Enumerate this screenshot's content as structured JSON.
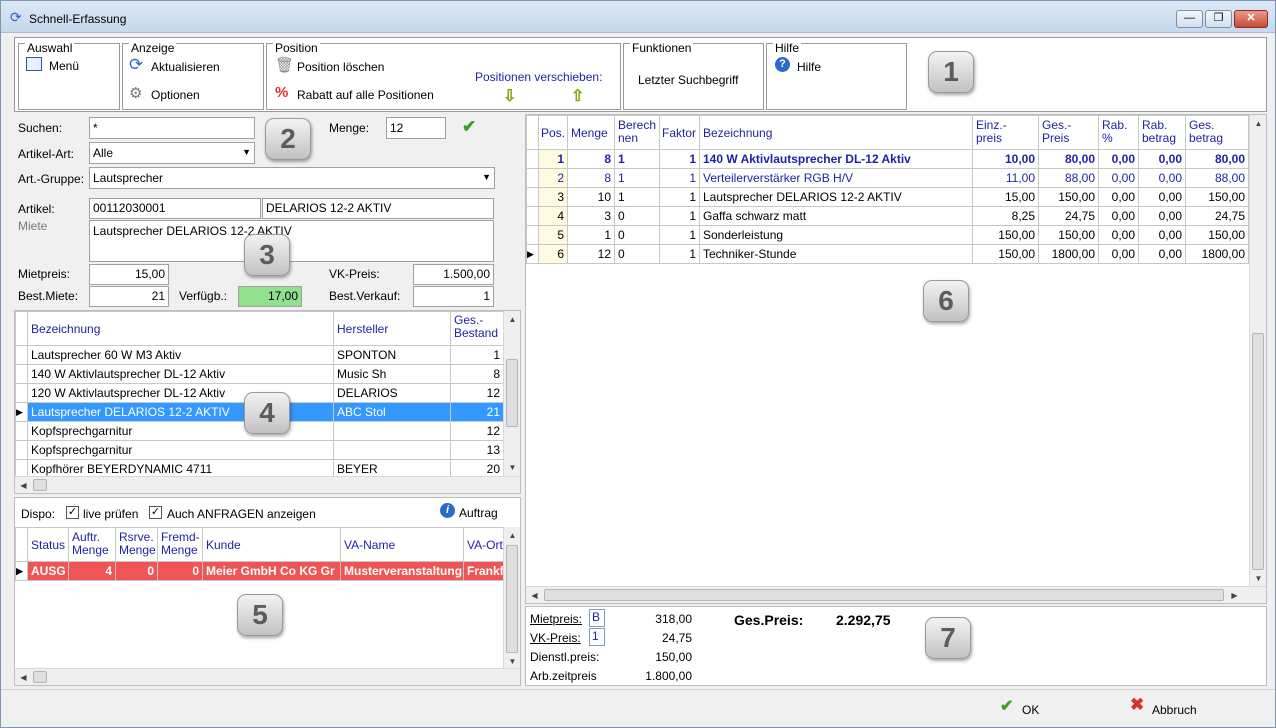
{
  "window": {
    "title": "Schnell-Erfassung",
    "min": "—",
    "max": "❐",
    "close": "✕"
  },
  "toolbar": {
    "auswahl": {
      "label": "Auswahl",
      "menu": "Menü"
    },
    "anzeige": {
      "label": "Anzeige",
      "refresh": "Aktualisieren",
      "options": "Optionen"
    },
    "position": {
      "label": "Position",
      "delete": "Position löschen",
      "discount": "Rabatt auf alle Positionen",
      "move_label": "Positionen verschieben:"
    },
    "funktionen": {
      "label": "Funktionen",
      "last_search": "Letzter Suchbegriff"
    },
    "hilfe": {
      "label": "Hilfe",
      "help": "Hilfe"
    }
  },
  "badges": [
    "1",
    "2",
    "3",
    "4",
    "5",
    "6",
    "7"
  ],
  "search": {
    "suchen_label": "Suchen:",
    "suchen_value": "*",
    "menge_label": "Menge:",
    "menge_value": "12",
    "artikelart_label": "Artikel-Art:",
    "artikelart_value": "Alle",
    "artgruppe_label": "Art.-Gruppe:",
    "artgruppe_value": "Lautsprecher"
  },
  "article": {
    "artikel_label": "Artikel:",
    "artikel_nr": "00112030001",
    "artikel_name": "DELARIOS 12-2 AKTIV",
    "miete_label": "Miete",
    "description": "Lautsprecher DELARIOS 12-2 AKTIV",
    "mietpreis_label": "Mietpreis:",
    "mietpreis": "15,00",
    "vkpreis_label": "VK-Preis:",
    "vkpreis": "1.500,00",
    "bestmiete_label": "Best.Miete:",
    "bestmiete": "21",
    "verfuegb_label": "Verfügb.:",
    "verfuegb": "17,00",
    "bestverkauf_label": "Best.Verkauf:",
    "bestverkauf": "1"
  },
  "article_list": {
    "headers": [
      "Bezeichnung",
      "Hersteller",
      "Ges.-\nBestand"
    ],
    "rows": [
      [
        "Lautsprecher 60 W M3 Aktiv",
        "SPONTON",
        "1"
      ],
      [
        "140 W Aktivlautsprecher DL-12 Aktiv",
        "Music Sh",
        "8"
      ],
      [
        "120 W Aktivlautsprecher DL-12 Aktiv",
        "DELARIOS",
        "12"
      ],
      [
        "Lautsprecher DELARIOS 12-2 AKTIV",
        "ABC Stol",
        "21"
      ],
      [
        "Kopfsprechgarnitur",
        "",
        "12"
      ],
      [
        "Kopfsprechgarnitur",
        "",
        "13"
      ],
      [
        "Kopfhörer BEYERDYNAMIC 4711",
        "BEYER",
        "20"
      ]
    ],
    "selected_index": 3
  },
  "dispo": {
    "label": "Dispo:",
    "live_label": "live prüfen",
    "anfragen_label": "Auch ANFRAGEN anzeigen",
    "auftrag_label": "Auftrag",
    "headers": [
      "Status",
      "Auftr.\nMenge",
      "Rsrve.\nMenge",
      "Fremd-\nMenge",
      "Kunde",
      "VA-Name",
      "VA-Ort"
    ],
    "rows": [
      [
        "AUSG",
        "4",
        "0",
        "0",
        "Meier GmbH  Co KG Gr",
        "Musterveranstaltung",
        "Frankf"
      ]
    ]
  },
  "positions": {
    "headers": [
      "Pos.",
      "Menge",
      "Berech\nnen",
      "Faktor",
      "Bezeichnung",
      "Einz.-\npreis",
      "Ges.-\nPreis",
      "Rab.\n%",
      "Rab.\nbetrag",
      "Ges.\nbetrag"
    ],
    "rows": [
      [
        "1",
        "8",
        "1",
        "1",
        "140 W Aktivlautsprecher DL-12 Aktiv",
        "10,00",
        "80,00",
        "0,00",
        "0,00",
        "80,00"
      ],
      [
        "2",
        "8",
        "1",
        "1",
        "Verteilerverstärker RGB H/V",
        "11,00",
        "88,00",
        "0,00",
        "0,00",
        "88,00"
      ],
      [
        "3",
        "10",
        "1",
        "1",
        "Lautsprecher DELARIOS 12-2 AKTIV",
        "15,00",
        "150,00",
        "0,00",
        "0,00",
        "150,00"
      ],
      [
        "4",
        "3",
        "0",
        "1",
        "Gaffa schwarz matt",
        "8,25",
        "24,75",
        "0,00",
        "0,00",
        "24,75"
      ],
      [
        "5",
        "1",
        "0",
        "1",
        "Sonderleistung",
        "150,00",
        "150,00",
        "0,00",
        "0,00",
        "150,00"
      ],
      [
        "6",
        "12",
        "0",
        "1",
        "Techniker-Stunde",
        "150,00",
        "1800,00",
        "0,00",
        "0,00",
        "1800,00"
      ]
    ],
    "current_index": 5
  },
  "summary": {
    "mietpreis_label": "Mietpreis:",
    "mietpreis_code": "B",
    "mietpreis": "318,00",
    "vkpreis_label": "VK-Preis:",
    "vkpreis_code": "1",
    "vkpreis": "24,75",
    "dienstl_label": "Dienstl.preis:",
    "dienstl": "150,00",
    "arbzeit_label": "Arb.zeitpreis",
    "arbzeit": "1.800,00",
    "gespreis_label": "Ges.Preis:",
    "gespreis": "2.292,75"
  },
  "footer": {
    "ok": "OK",
    "cancel": "Abbruch"
  },
  "colors": {
    "accent": "#1f1fa8",
    "selection": "#3399ff",
    "alert_row": "#f05555",
    "available": "#8fe08f"
  }
}
